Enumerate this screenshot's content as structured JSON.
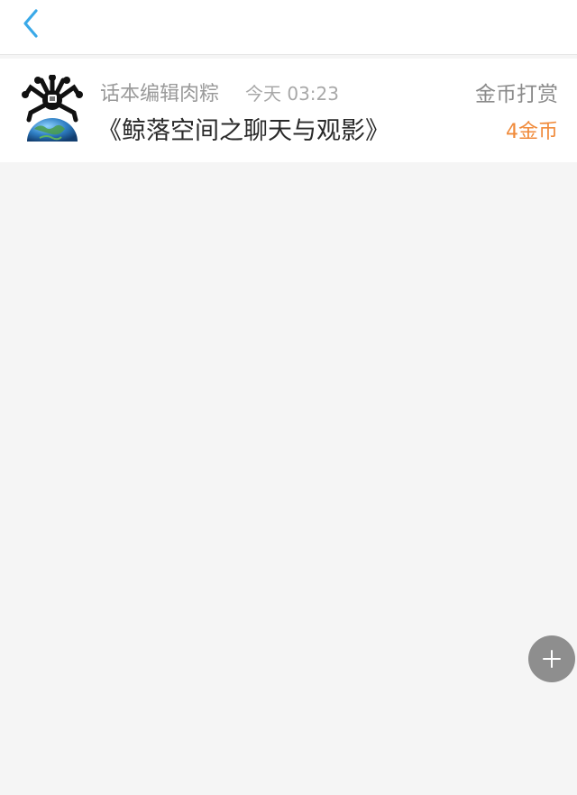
{
  "header": {
    "back_icon": "chevron-left-icon"
  },
  "reward_item": {
    "avatar_icon": "avatar-image",
    "author": "话本编辑肉粽",
    "time": "今天 03:23",
    "title": "《鲸落空间之聊天与观影》",
    "action": "金币打赏",
    "amount": "4金币"
  },
  "fab": {
    "icon": "plus-icon"
  },
  "colors": {
    "accent_blue": "#3aa9e8",
    "coin_orange": "#f08a3a",
    "background": "#f5f5f5",
    "fab_gray": "#8e8e8e"
  }
}
